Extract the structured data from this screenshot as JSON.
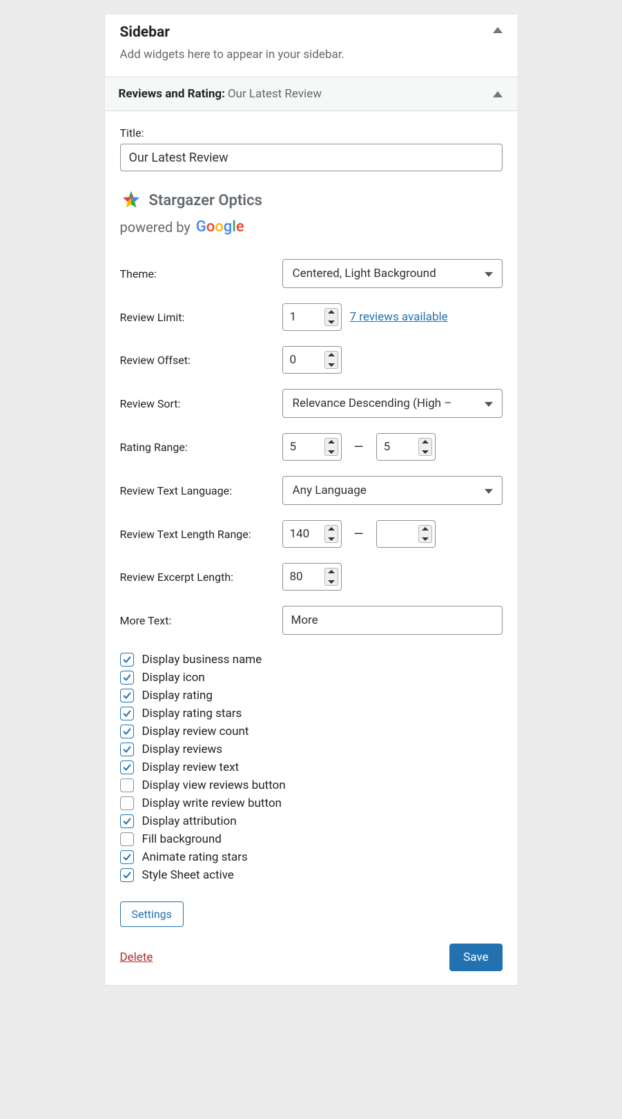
{
  "sidebar": {
    "title": "Sidebar",
    "description": "Add widgets here to appear in your sidebar."
  },
  "widget": {
    "name": "Reviews and Rating:",
    "instance": "Our Latest Review"
  },
  "form": {
    "title_label": "Title:",
    "title_value": "Our Latest Review",
    "business_name": "Stargazer Optics",
    "powered_by": "powered by",
    "google": {
      "g": "G",
      "o1": "o",
      "o2": "o",
      "g2": "g",
      "l": "l",
      "e": "e"
    },
    "theme_label": "Theme:",
    "theme_value": "Centered, Light Background",
    "review_limit_label": "Review Limit:",
    "review_limit_value": "1",
    "reviews_available": "7 reviews available",
    "review_offset_label": "Review Offset:",
    "review_offset_value": "0",
    "review_sort_label": "Review Sort:",
    "review_sort_value": "Relevance Descending (High – ",
    "rating_range_label": "Rating Range:",
    "rating_range_min": "5",
    "rating_range_max": "5",
    "review_lang_label": "Review Text Language:",
    "review_lang_value": "Any Language",
    "text_len_label": "Review Text Length Range:",
    "text_len_min": "140",
    "text_len_max": "",
    "excerpt_label": "Review Excerpt Length:",
    "excerpt_value": "80",
    "more_text_label": "More Text:",
    "more_text_value": "More",
    "dash": "—"
  },
  "checkboxes": [
    {
      "label": "Display business name",
      "checked": true
    },
    {
      "label": "Display icon",
      "checked": true
    },
    {
      "label": "Display rating",
      "checked": true
    },
    {
      "label": "Display rating stars",
      "checked": true
    },
    {
      "label": "Display review count",
      "checked": true
    },
    {
      "label": "Display reviews",
      "checked": true
    },
    {
      "label": "Display review text",
      "checked": true
    },
    {
      "label": "Display view reviews button",
      "checked": false
    },
    {
      "label": "Display write review button",
      "checked": false
    },
    {
      "label": "Display attribution",
      "checked": true
    },
    {
      "label": "Fill background",
      "checked": false
    },
    {
      "label": "Animate rating stars",
      "checked": true
    },
    {
      "label": "Style Sheet active",
      "checked": true
    }
  ],
  "buttons": {
    "settings": "Settings",
    "delete": "Delete",
    "save": "Save"
  }
}
